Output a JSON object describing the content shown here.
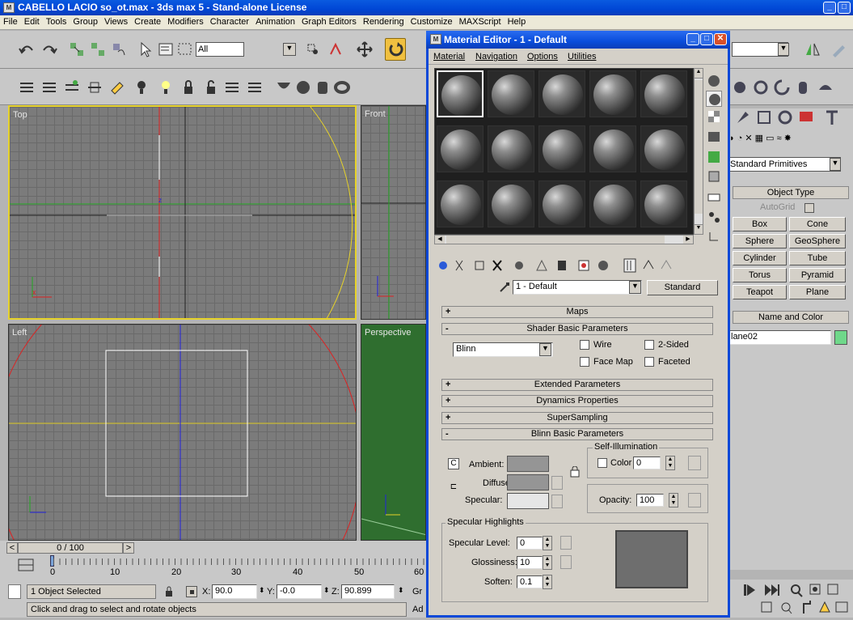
{
  "titlebar": {
    "title": "CABELLO LACIO so_ot.max - 3ds max 5 - Stand-alone License",
    "icon": "3ds-max-icon"
  },
  "menubar": {
    "items": [
      "File",
      "Edit",
      "Tools",
      "Group",
      "Views",
      "Create",
      "Modifiers",
      "Character",
      "Animation",
      "Graph Editors",
      "Rendering",
      "Customize",
      "MAXScript",
      "Help"
    ]
  },
  "toolbar": {
    "selection_filter": "All"
  },
  "viewports": {
    "top": "Top",
    "front": "Front",
    "left": "Left",
    "perspective": "Perspective"
  },
  "material_editor": {
    "title": "Material Editor - 1 - Default",
    "menu": [
      "Material",
      "Navigation",
      "Options",
      "Utilities"
    ],
    "material_name": "1 - Default",
    "material_type": "Standard",
    "rollouts": {
      "maps": "Maps",
      "shader_basic": "Shader Basic Parameters",
      "extended": "Extended Parameters",
      "dynamics": "Dynamics Properties",
      "supersampling": "SuperSampling",
      "blinn_basic": "Blinn Basic Parameters"
    },
    "shader": {
      "type": "Blinn",
      "wire": "Wire",
      "two_sided": "2-Sided",
      "face_map": "Face Map",
      "faceted": "Faceted"
    },
    "blinn": {
      "ambient_label": "Ambient:",
      "diffuse_label": "Diffuse:",
      "specular_label": "Specular:",
      "self_illum_title": "Self-Illumination",
      "color_label": "Color",
      "color_value": "0",
      "opacity_label": "Opacity:",
      "opacity_value": "100",
      "spec_highlights_title": "Specular Highlights",
      "spec_level_label": "Specular Level:",
      "spec_level_value": "0",
      "glossiness_label": "Glossiness:",
      "glossiness_value": "10",
      "soften_label": "Soften:",
      "soften_value": "0.1",
      "colors": {
        "ambient": "#959595",
        "diffuse": "#959595",
        "specular": "#e6e6e6",
        "highlight_preview": "#6e6e6e"
      }
    }
  },
  "command_panel": {
    "category": "Standard Primitives",
    "object_type_title": "Object Type",
    "autogrid": "AutoGrid",
    "buttons": [
      "Box",
      "Cone",
      "Sphere",
      "GeoSphere",
      "Cylinder",
      "Tube",
      "Torus",
      "Pyramid",
      "Teapot",
      "Plane"
    ],
    "name_color_title": "Name and Color",
    "object_name": "lane02",
    "object_color": "#6fd88a"
  },
  "timeline": {
    "frame_display": "0 / 100",
    "ticks": [
      "0",
      "10",
      "20",
      "30",
      "40",
      "50",
      "60"
    ]
  },
  "status": {
    "selection": "1 Object Selected",
    "x_label": "X:",
    "x_value": "90.0",
    "y_label": "Y:",
    "y_value": "-0.0",
    "z_label": "Z:",
    "z_value": "90.899",
    "grid_label": "Gr",
    "add_label": "Ad",
    "prompt": "Click and drag to select and rotate objects"
  }
}
